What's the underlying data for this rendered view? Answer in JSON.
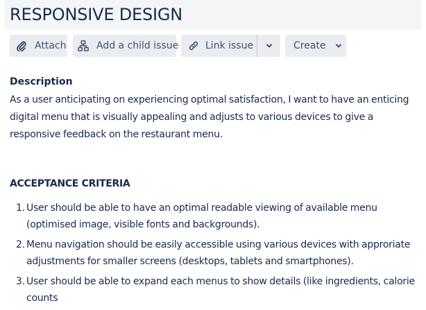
{
  "issue": {
    "title": "RESPONSIVE DESIGN"
  },
  "toolbar": {
    "attach": {
      "label": "Attach",
      "icon": "paperclip-icon"
    },
    "add_child": {
      "label": "Add a child issue",
      "icon": "hierarchy-icon"
    },
    "link_issue": {
      "label": "Link issue",
      "icon": "link-icon",
      "more_icon": "chevron-down-icon"
    },
    "create": {
      "label": "Create",
      "icon": "chevron-down-icon"
    }
  },
  "description": {
    "heading": "Description",
    "text": "As a user anticipating on experiencing optimal satisfaction, I want to have an enticing digital menu that is visually appealing and adjusts to various devices to give a responsive feedback on the restaurant menu."
  },
  "acceptance_criteria": {
    "heading": "ACCEPTANCE CRITERIA",
    "items": [
      {
        "number": "1.",
        "text": "User should be able to have an optimal readable viewing of available menu (optimised image, visible fonts and backgrounds)."
      },
      {
        "number": "2.",
        "text": "Menu navigation should be easily accessible using various devices with approriate adjustments for smaller screens (desktops, tablets and smartphones)."
      },
      {
        "number": "3.",
        "text": "User should be able to expand each menus to show details (like ingredients, calorie counts"
      }
    ]
  },
  "colors": {
    "text": "#172b4d",
    "button_bg": "#ebecf0",
    "button_text": "#42526e",
    "title_bar_bg": "#f4f5f7"
  }
}
